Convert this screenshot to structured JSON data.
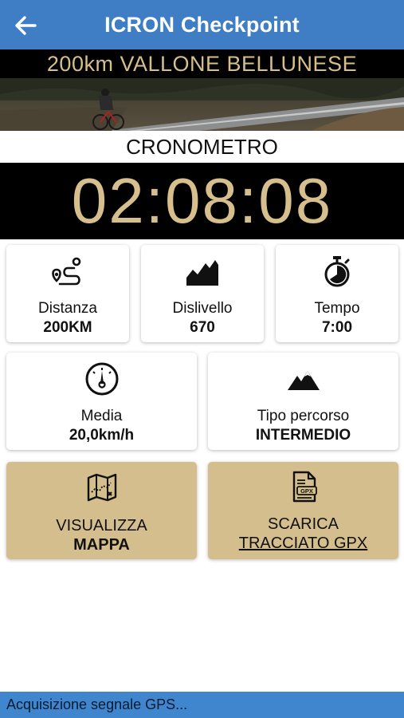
{
  "header": {
    "title": "ICRON Checkpoint",
    "back_icon": "arrow-left-icon"
  },
  "event": {
    "name": "200km VALLONE BELLUNESE"
  },
  "timer": {
    "label": "CRONOMETRO",
    "value": "02:08:08"
  },
  "stats": [
    {
      "icon": "route-icon",
      "label": "Distanza",
      "value": "200KM"
    },
    {
      "icon": "elevation-icon",
      "label": "Dislivello",
      "value": "670"
    },
    {
      "icon": "stopwatch-icon",
      "label": "Tempo",
      "value": "7:00"
    },
    {
      "icon": "speedometer-icon",
      "label": "Media",
      "value": "20,0km/h"
    },
    {
      "icon": "mountain-icon",
      "label": "Tipo percorso",
      "value": "INTERMEDIO"
    }
  ],
  "actions": {
    "map": {
      "icon": "map-icon",
      "line1": "VISUALIZZA",
      "line2": "MAPPA"
    },
    "gpx": {
      "icon": "gpx-file-icon",
      "line1": "SCARICA",
      "line2": "TRACCIATO GPX"
    }
  },
  "status": {
    "text": "Acquisizione segnale GPS..."
  },
  "colors": {
    "header_blue": "#3f7dc5",
    "gold": "#d6bf8d",
    "card_gold": "#d5be8d",
    "status_blue": "#3f86cf"
  }
}
